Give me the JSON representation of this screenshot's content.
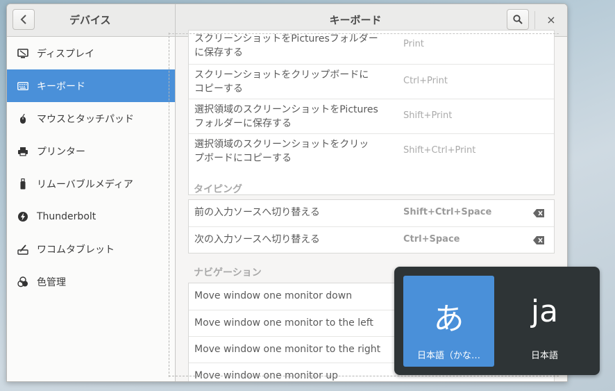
{
  "header": {
    "left_title": "デバイス",
    "main_title": "キーボード",
    "close_label": "×"
  },
  "sidebar": {
    "items": [
      {
        "label": "ディスプレイ",
        "icon": "display-icon"
      },
      {
        "label": "キーボード",
        "icon": "keyboard-icon",
        "active": true
      },
      {
        "label": "マウスとタッチパッド",
        "icon": "mouse-icon"
      },
      {
        "label": "プリンター",
        "icon": "printer-icon"
      },
      {
        "label": "リムーバブルメディア",
        "icon": "usb-drive-icon"
      },
      {
        "label": "Thunderbolt",
        "icon": "thunderbolt-icon"
      },
      {
        "label": "ワコムタブレット",
        "icon": "tablet-icon"
      },
      {
        "label": "色管理",
        "icon": "color-management-icon"
      }
    ]
  },
  "screenshots": {
    "rows": [
      {
        "label_line1": "スクリーンショットをPicturesフォルダー",
        "label_line2": "に保存する",
        "accel": "Print"
      },
      {
        "label_line1": "スクリーンショットをクリップボードに",
        "label_line2": "コピーする",
        "accel": "Ctrl+Print"
      },
      {
        "label_line1": "選択領域のスクリーンショットをPictures",
        "label_line2": "フォルダーに保存する",
        "accel": "Shift+Print"
      },
      {
        "label_line1": "選択領域のスクリーンショットをクリッ",
        "label_line2": "プボードにコピーする",
        "accel": "Shift+Ctrl+Print"
      }
    ]
  },
  "typing": {
    "title": "タイピング",
    "rows": [
      {
        "label": "前の入力ソースへ切り替える",
        "accel": "Shift+Ctrl+Space"
      },
      {
        "label": "次の入力ソースへ切り替える",
        "accel": "Ctrl+Space"
      }
    ]
  },
  "navigation": {
    "title": "ナビゲーション",
    "rows": [
      {
        "label": "Move window one monitor down"
      },
      {
        "label": "Move window one monitor to the left"
      },
      {
        "label": "Move window one monitor to the right"
      },
      {
        "label": "Move window one monitor up"
      }
    ]
  },
  "input_switcher": {
    "items": [
      {
        "glyph": "あ",
        "name": "日本語（かな…",
        "selected": true
      },
      {
        "glyph": "ja",
        "name": "日本語",
        "selected": false
      }
    ]
  },
  "colors": {
    "accent": "#4a90d9",
    "switcher_bg": "#2e3436"
  }
}
